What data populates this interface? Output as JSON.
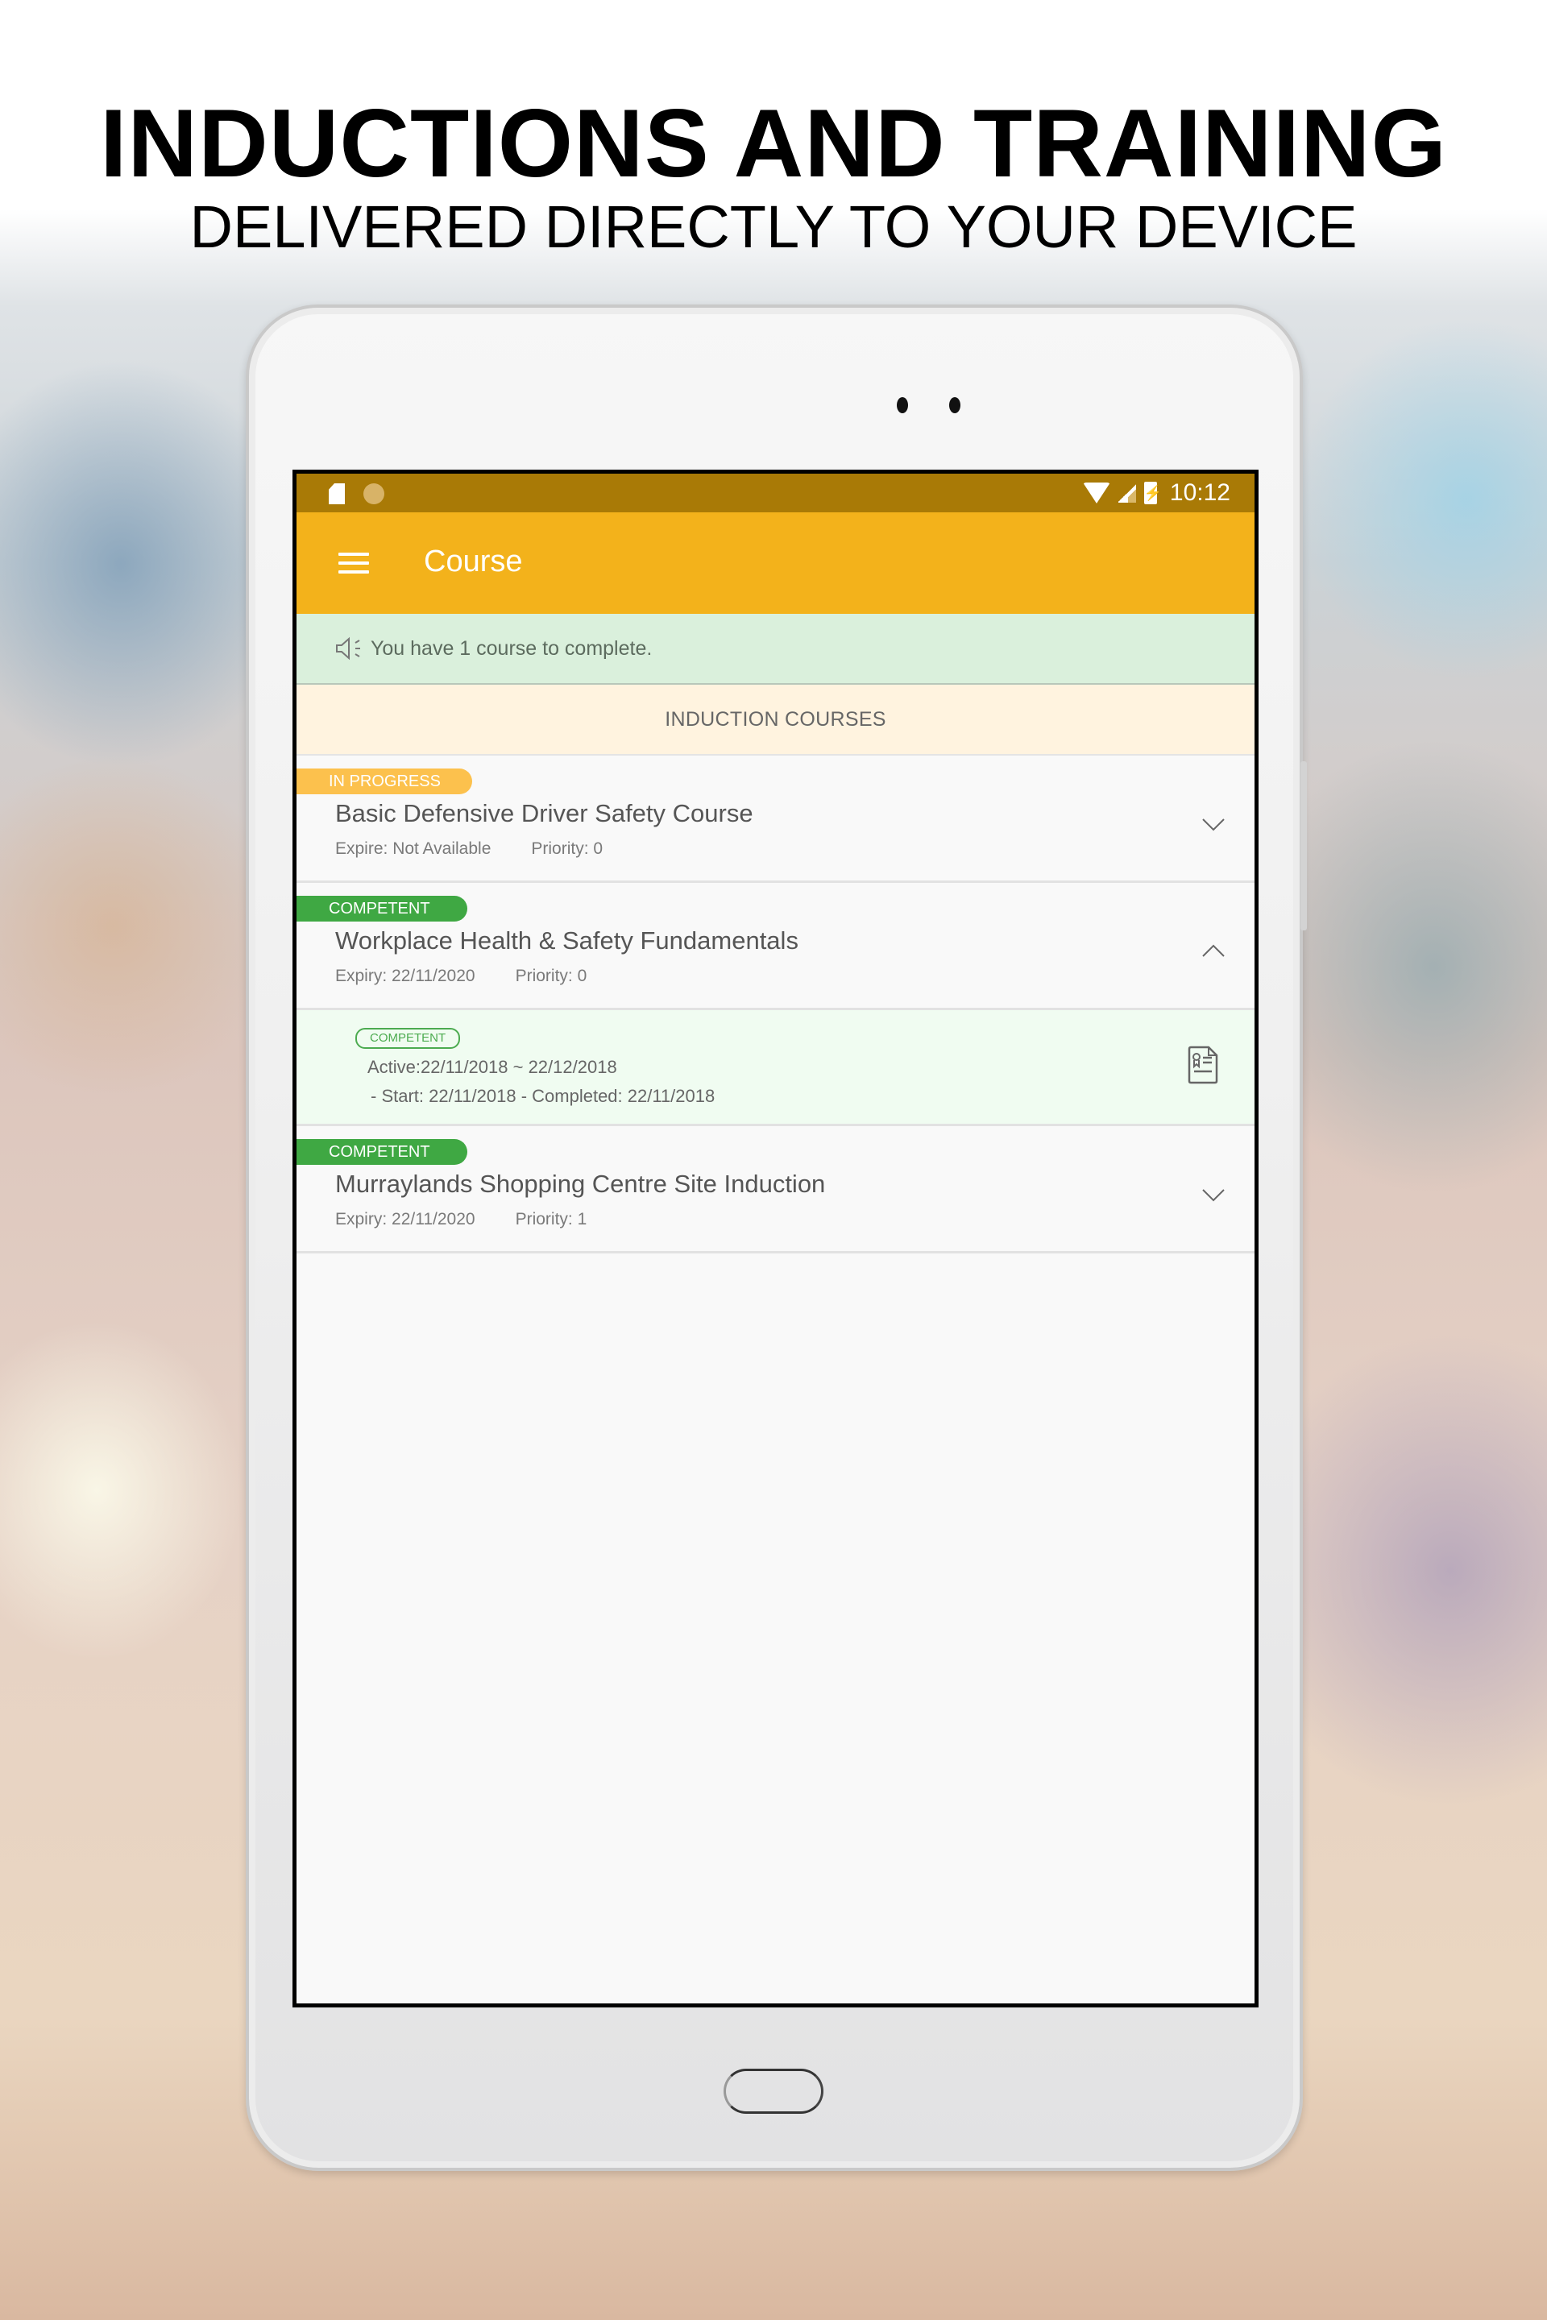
{
  "promo": {
    "headline": "INDUCTIONS AND TRAINING",
    "subheadline": "DELIVERED DIRECTLY TO YOUR DEVICE"
  },
  "status_bar": {
    "left_icons": [
      "sd-card-icon",
      "sync-icon"
    ],
    "right_icons": [
      "wifi-icon",
      "signal-icon",
      "battery-charging-icon"
    ],
    "time": "10:12"
  },
  "app_bar": {
    "menu_icon": "menu-icon",
    "title": "Course"
  },
  "notice": {
    "icon": "speaker-icon",
    "text": "You have 1 course to complete."
  },
  "section": {
    "title": "INDUCTION COURSES"
  },
  "courses": [
    {
      "status": "IN PROGRESS",
      "status_color": "#fcc14d",
      "title": "Basic Defensive Driver Safety Course",
      "expiry": "Expire: Not Available",
      "priority": "Priority: 0",
      "expanded": false
    },
    {
      "status": "COMPETENT",
      "status_color": "#3fa843",
      "title": "Workplace Health & Safety Fundamentals",
      "expiry": "Expiry: 22/11/2020",
      "priority": "Priority: 0",
      "expanded": true,
      "detail": {
        "status": "COMPETENT",
        "active": "Active:22/11/2018 ~ 22/12/2018",
        "dates": "- Start: 22/11/2018 - Completed: 22/11/2018",
        "icon": "certificate-icon"
      }
    },
    {
      "status": "COMPETENT",
      "status_color": "#3fa843",
      "title": "Murraylands Shopping Centre Site Induction",
      "expiry": "Expiry: 22/11/2020",
      "priority": "Priority: 1",
      "expanded": false
    }
  ],
  "colors": {
    "status_bar": "#a97a06",
    "app_bar": "#f3b21b",
    "notice_bg": "#daf0dc",
    "section_bg": "#fff3df",
    "in_progress": "#fcc14d",
    "competent": "#3fa843"
  }
}
